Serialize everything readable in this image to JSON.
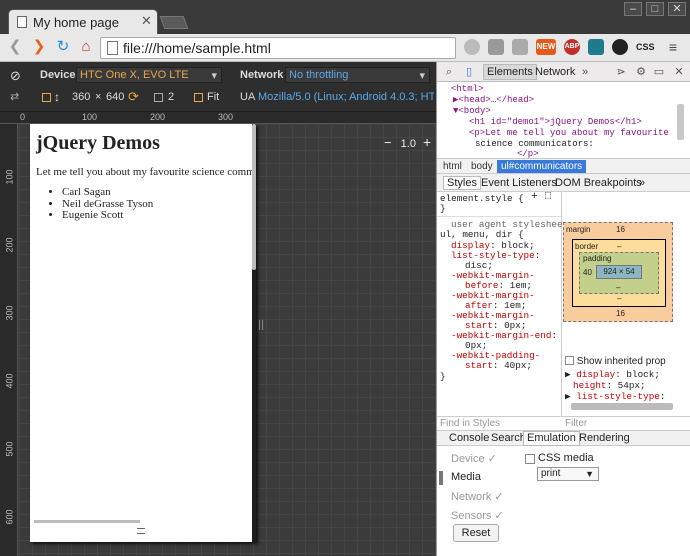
{
  "browser": {
    "tab_title": "My home page",
    "tab_close": "✕",
    "url": "file:///home/sample.html",
    "window_buttons": [
      "–",
      "□",
      "✕"
    ],
    "ext_new": "NEW",
    "ext_abp": "ABP",
    "ext_css": "CSS"
  },
  "emulation_bar": {
    "device_label": "Device",
    "device_value": "HTC One X, EVO LTE",
    "network_label": "Network",
    "network_value": "No throttling",
    "width": "360",
    "times": "×",
    "height": "640",
    "dpr": "2",
    "fit_label": "Fit",
    "ua_label": "UA",
    "ua_value": "Mozilla/5.0 (Linux; Android 4.0.3; HTC ..."
  },
  "zoom": {
    "minus": "−",
    "value": "1.0",
    "plus": "+"
  },
  "ruler": {
    "top": [
      "0",
      "100",
      "200",
      "300"
    ],
    "left": [
      "100",
      "200",
      "300",
      "400",
      "500",
      "600"
    ]
  },
  "page": {
    "title": "jQuery Demos",
    "paragraph": "Let me tell you about my favourite science communicators:",
    "items": [
      "Carl Sagan",
      "Neil deGrasse Tyson",
      "Eugenie Scott"
    ]
  },
  "devtools": {
    "tabs": [
      "Elements",
      "Network"
    ],
    "dom": [
      "<html>",
      "▶<head>…</head>",
      "▼<body>",
      "<h1 id=\"demo1\">jQuery Demos</h1>",
      "<p>Let me tell you about my favourite",
      "science communicators:",
      "</p>"
    ],
    "crumbs": [
      "html",
      "body",
      "ul#communicators"
    ],
    "sub_tabs": [
      "Styles",
      "Event Listeners",
      "DOM Breakpoints",
      "»"
    ],
    "element_style": "element.style {",
    "element_style_close": "}",
    "ua_stylesheet": "user agent stylesheet",
    "selector": "ul, menu, dir {",
    "rules": [
      {
        "p": "display",
        "v": "block;"
      },
      {
        "p": "list-style-type",
        "v": "disc;"
      },
      {
        "p": "-webkit-margin-before",
        "v": "1em;"
      },
      {
        "p": "-webkit-margin-after",
        "v": "1em;"
      },
      {
        "p": "-webkit-margin-start",
        "v": "0px;"
      },
      {
        "p": "-webkit-margin-end",
        "v": "0px;"
      },
      {
        "p": "-webkit-padding-start",
        "v": "40px;"
      }
    ],
    "close_brace": "}",
    "box_model": {
      "margin_label": "margin",
      "margin_top": "16",
      "margin_bottom": "16",
      "border_label": "border",
      "border_val": "–",
      "padding_label": "padding",
      "padding_val": "–",
      "padding_left": "40",
      "content": "924 × 54"
    },
    "show_inherited": "Show inherited prop",
    "computed": [
      {
        "p": "display",
        "v": "block;"
      },
      {
        "p": "height",
        "v": "54px;"
      },
      {
        "p": "list-style-type",
        "v": ""
      }
    ],
    "find_placeholder": "Find in Styles",
    "filter_placeholder": "Filter",
    "drawer_tabs": [
      "Console",
      "Search",
      "Emulation",
      "Rendering"
    ],
    "emulation_items": [
      "Device ✓",
      "Media",
      "Network ✓",
      "Sensors ✓"
    ],
    "css_media_label": "CSS media",
    "css_media_value": "print",
    "reset_label": "Reset"
  }
}
